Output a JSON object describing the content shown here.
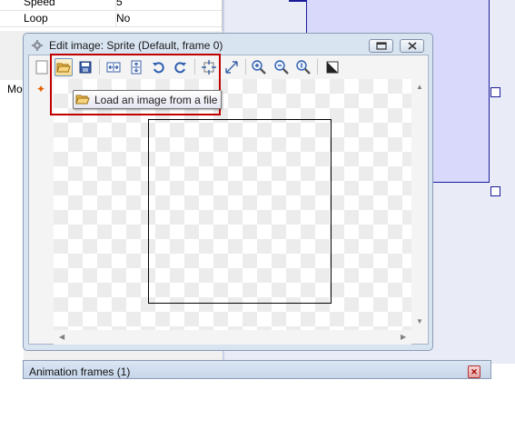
{
  "properties": [
    {
      "name": "Speed",
      "value": "5"
    },
    {
      "name": "Loop",
      "value": "No"
    }
  ],
  "left_panel_label": "Mo",
  "dialog": {
    "title": "Edit image: Sprite (Default, frame 0)",
    "title_buttons": [
      "maximize-icon",
      "close-icon"
    ]
  },
  "toolbar": {
    "buttons": [
      "new-image-icon",
      "open-folder-icon",
      "save-icon",
      "flip-horizontal-icon",
      "flip-vertical-icon",
      "rotate-left-icon",
      "rotate-right-icon",
      "set-hotspot-icon",
      "resize-icon",
      "zoom-in-icon",
      "zoom-out-icon",
      "zoom-reset-icon",
      "transparency-icon"
    ],
    "tooltip": "Load an image from a file"
  },
  "bottom_panel": {
    "title": "Animation frames (1)"
  },
  "colors": {
    "highlight": "#c00000",
    "sprite_selection": "#d9d9fb",
    "sprite_border": "#1b1b9a"
  }
}
